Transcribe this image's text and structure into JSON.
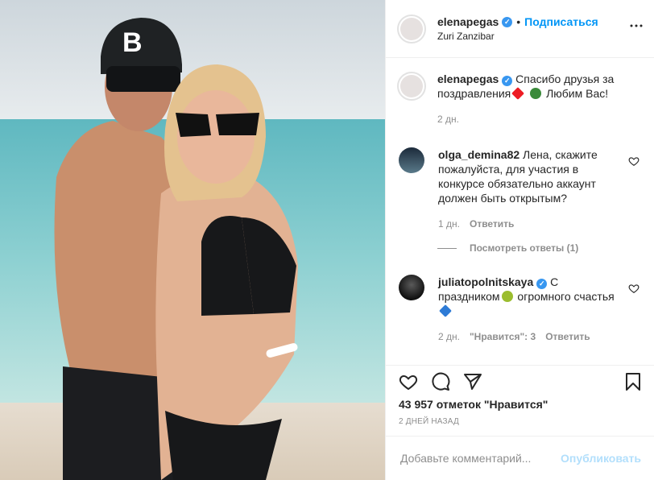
{
  "post": {
    "author": {
      "username": "elenapegas",
      "verified": true,
      "follow_label": "Подписаться",
      "separator": "•",
      "location": "Zuri Zanzibar"
    },
    "caption": {
      "username": "elenapegas",
      "text_part1": "Спасибо друзья за поздравления",
      "text_part2": "Любим Вас!",
      "time": "2 дн."
    },
    "comments": [
      {
        "username": "olga_demina82",
        "text": "Лена, скажите пожалуйста, для участия в конкурсе обязательно аккаунт должен быть открытым?",
        "time": "1 дн.",
        "reply_label": "Ответить",
        "view_replies": "Посмотреть ответы (1)"
      },
      {
        "username": "juliatopolnitskaya",
        "verified": true,
        "text_part1": "С праздником",
        "text_part2": "огромного счастья",
        "time": "2 дн.",
        "likes_label": "\"Нравится\": 3",
        "reply_label": "Ответить"
      }
    ],
    "likes_text": "43 957 отметок \"Нравится\"",
    "date_text": "2 ДНЕЙ НАЗАД",
    "add_comment": {
      "placeholder": "Добавьте комментарий...",
      "publish_label": "Опубликовать"
    },
    "icons": {
      "like": "heart-icon",
      "comment": "comment-icon",
      "share": "share-icon",
      "save": "bookmark-icon"
    },
    "colors": {
      "accent": "#0095f6",
      "verified": "#3897f0",
      "heart": "#ed4956",
      "publish_disabled": "#b2dffc"
    }
  }
}
